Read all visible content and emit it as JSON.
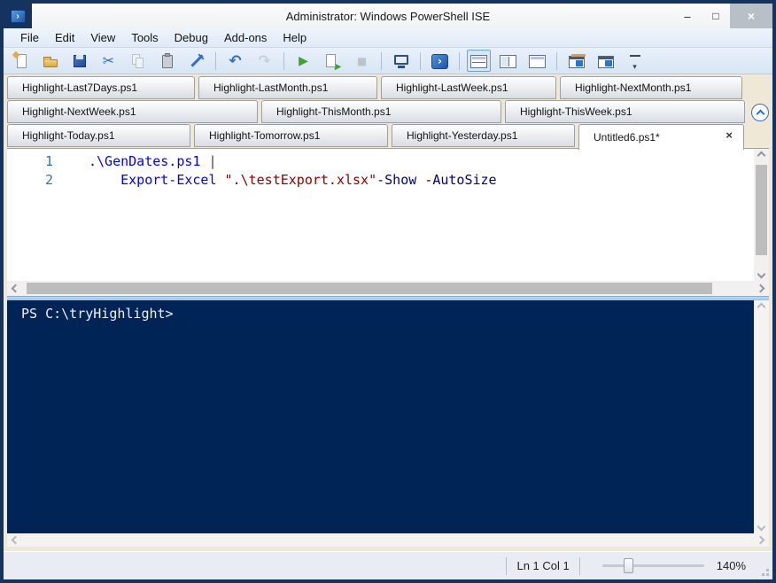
{
  "window": {
    "title": "Administrator: Windows PowerShell ISE",
    "app_icon_glyph": "›",
    "controls": {
      "minimize": "–",
      "maximize": "□",
      "close": "×"
    }
  },
  "menubar": {
    "items": [
      "File",
      "Edit",
      "View",
      "Tools",
      "Debug",
      "Add-ons",
      "Help"
    ]
  },
  "toolbar": {
    "items": [
      {
        "name": "new-script-button",
        "icon": "new-file-icon",
        "kind": "new"
      },
      {
        "name": "open-script-button",
        "icon": "open-folder-icon",
        "kind": "open"
      },
      {
        "name": "save-button",
        "icon": "save-icon",
        "kind": "save"
      },
      {
        "name": "cut-button",
        "icon": "cut-icon",
        "kind": "cut",
        "glyph": "✂"
      },
      {
        "name": "copy-button",
        "icon": "copy-icon",
        "kind": "copy",
        "disabled": true
      },
      {
        "name": "paste-button",
        "icon": "paste-icon",
        "kind": "paste"
      },
      {
        "name": "clear-console-button",
        "icon": "clear-console-icon",
        "kind": "clear"
      },
      {
        "kind": "sep"
      },
      {
        "name": "undo-button",
        "icon": "undo-icon",
        "kind": "undo",
        "glyph": "↶"
      },
      {
        "name": "redo-button",
        "icon": "redo-icon",
        "kind": "redo",
        "glyph": "↷",
        "disabled": true
      },
      {
        "kind": "sep"
      },
      {
        "name": "run-script-button",
        "icon": "run-icon",
        "kind": "run",
        "glyph": "▶"
      },
      {
        "name": "run-selection-button",
        "icon": "run-selection-icon",
        "kind": "runsel",
        "glyph": "▶"
      },
      {
        "name": "stop-button",
        "icon": "stop-icon",
        "kind": "stop",
        "glyph": "■",
        "disabled": true
      },
      {
        "kind": "sep"
      },
      {
        "name": "new-remote-powershell-tab-button",
        "icon": "remote-computer-icon",
        "kind": "remote"
      },
      {
        "kind": "sep"
      },
      {
        "name": "start-powershell-button",
        "icon": "powershell-console-icon",
        "kind": "psconsole",
        "glyph": "›"
      },
      {
        "kind": "sep"
      },
      {
        "name": "show-script-pane-top-button",
        "icon": "script-pane-top-icon",
        "kind": "layout-top",
        "selected": true
      },
      {
        "name": "show-script-pane-right-button",
        "icon": "script-pane-right-icon",
        "kind": "layout-right"
      },
      {
        "name": "show-script-pane-maximized-button",
        "icon": "script-pane-max-icon",
        "kind": "layout-max"
      },
      {
        "kind": "sep"
      },
      {
        "name": "new-powershell-tab-button",
        "icon": "new-powershell-tab-icon",
        "kind": "newtab"
      },
      {
        "name": "close-powershell-tab-button",
        "icon": "close-powershell-tab-icon",
        "kind": "closetab"
      },
      {
        "name": "toolbar-overflow-button",
        "icon": "overflow-icon",
        "kind": "overflow",
        "glyph": "▾"
      }
    ]
  },
  "tabs": {
    "close_glyph": "×",
    "rows": [
      [
        {
          "label": "Highlight-Last7Days.ps1"
        },
        {
          "label": "Highlight-LastMonth.ps1"
        },
        {
          "label": "Highlight-LastWeek.ps1"
        },
        {
          "label": "Highlight-NextMonth.ps1"
        }
      ],
      [
        {
          "label": "Highlight-NextWeek.ps1"
        },
        {
          "label": "Highlight-ThisMonth.ps1"
        },
        {
          "label": "Highlight-ThisWeek.ps1"
        }
      ],
      [
        {
          "label": "Highlight-Today.ps1"
        },
        {
          "label": "Highlight-Tomorrow.ps1"
        },
        {
          "label": "Highlight-Yesterday.ps1"
        },
        {
          "label": "Untitled6.ps1*",
          "active": true,
          "close": true
        }
      ]
    ]
  },
  "editor": {
    "token_colors": {
      "command": "#0000ff",
      "plain": "#000000",
      "operator": "#404040",
      "string": "#8b0000",
      "parameter": "#000080"
    },
    "lines": [
      {
        "number": "1",
        "tokens": [
          {
            "t": ".\\GenDates.ps1",
            "c": "command"
          },
          {
            "t": " ",
            "c": "plain"
          },
          {
            "t": "|",
            "c": "operator"
          }
        ]
      },
      {
        "number": "2",
        "tokens": [
          {
            "t": "    ",
            "c": "plain"
          },
          {
            "t": "Export-Excel",
            "c": "command"
          },
          {
            "t": " ",
            "c": "plain"
          },
          {
            "t": "\".\\testExport.xlsx\"",
            "c": "string"
          },
          {
            "t": "-Show",
            "c": "parameter"
          },
          {
            "t": " ",
            "c": "plain"
          },
          {
            "t": "-AutoSize",
            "c": "parameter"
          }
        ]
      }
    ]
  },
  "console": {
    "prompt": "PS C:\\tryHighlight>"
  },
  "statusbar": {
    "line_col": "Ln 1 Col 1",
    "zoom": "140%"
  },
  "colors": {
    "frame": "#14335f",
    "console_bg": "#012456",
    "client_bg": "#efe8d6",
    "bar_bg": "#dce9f8",
    "line_number": "#2e75b6"
  }
}
